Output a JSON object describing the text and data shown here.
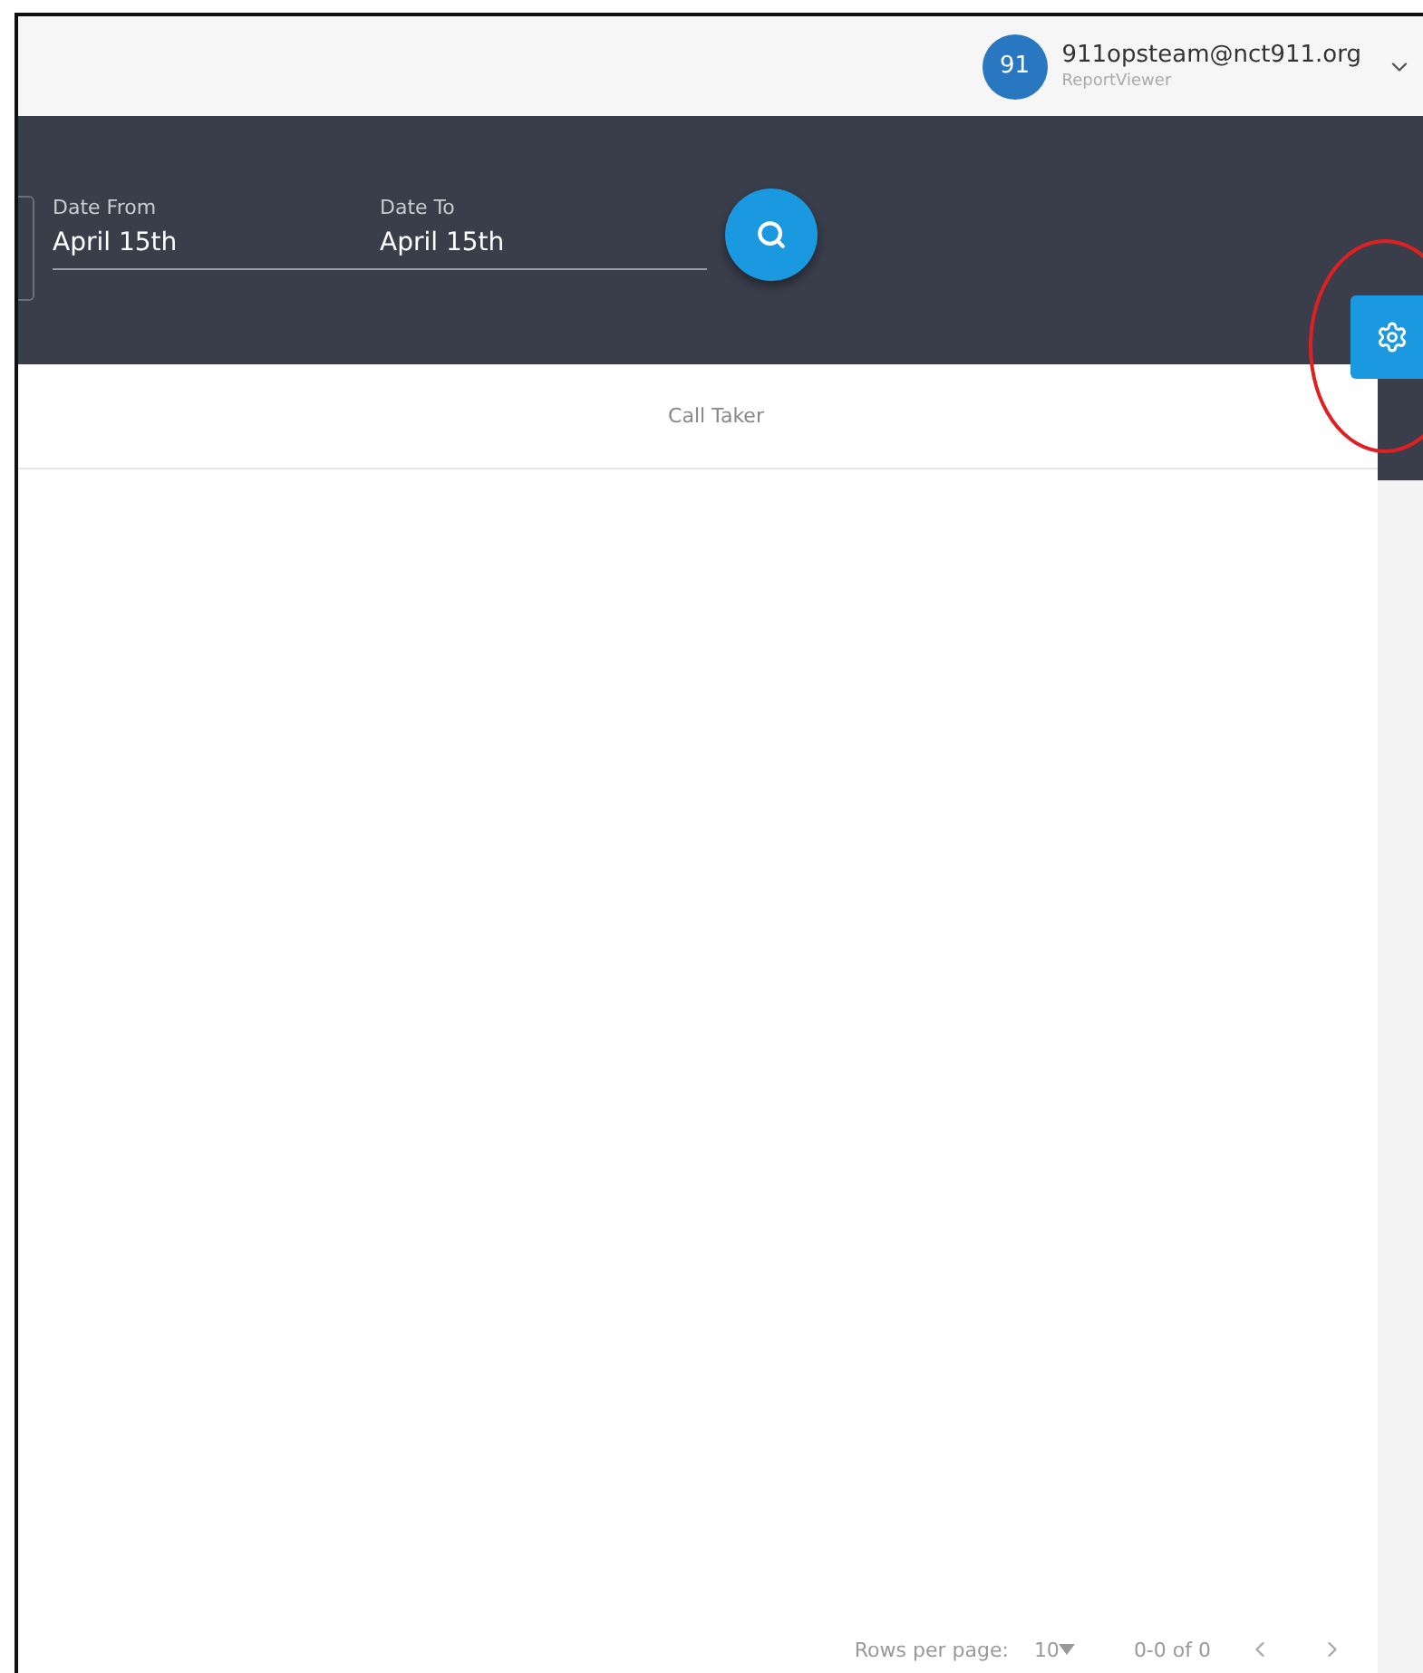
{
  "user": {
    "avatar": "91",
    "email": "911opsteam@nct911.org",
    "role": "ReportViewer"
  },
  "filters": [
    {
      "label": "Date From",
      "value": "April 15th"
    },
    {
      "label": "Date To",
      "value": "April 15th"
    }
  ],
  "table": {
    "columns": [
      "Call Taker"
    ]
  },
  "pagination": {
    "rows_per_page_label": "Rows per page:",
    "rows_per_page": "10",
    "range": "0-0 of 0"
  }
}
